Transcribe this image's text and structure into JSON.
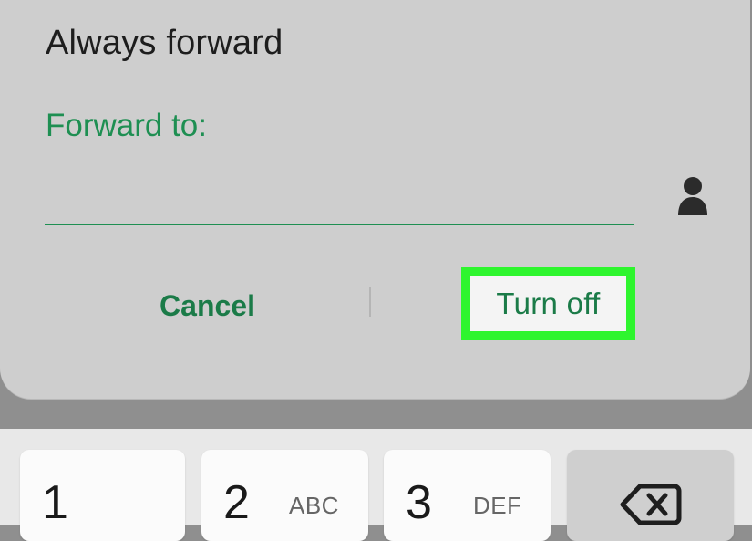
{
  "dialog": {
    "title": "Always forward",
    "field_label": "Forward to:",
    "input_value": "",
    "contact_icon": "contact-person-icon",
    "cancel_label": "Cancel",
    "turn_off_label": "Turn off",
    "highlight_color": "#2ef52e",
    "accent_color": "#1e8f52"
  },
  "keypad": {
    "keys": [
      {
        "digit": "1",
        "letters": ""
      },
      {
        "digit": "2",
        "letters": "ABC"
      },
      {
        "digit": "3",
        "letters": "DEF"
      }
    ],
    "delete_icon": "backspace-icon"
  }
}
